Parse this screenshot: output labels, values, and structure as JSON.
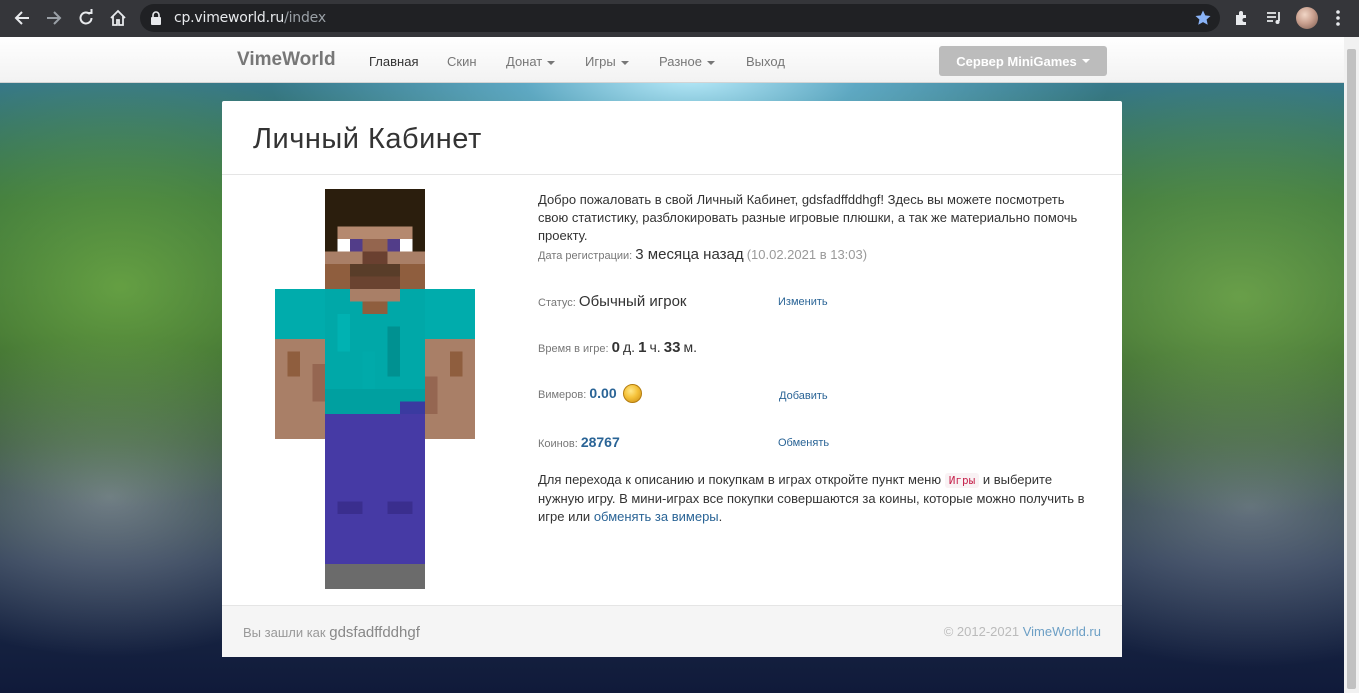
{
  "browser": {
    "url_host": "cp.vimeworld.ru",
    "url_path": "/index",
    "icons": [
      "back-arrow-icon",
      "forward-arrow-icon",
      "reload-icon",
      "home-icon",
      "lock-icon",
      "star-icon",
      "extensions-icon",
      "media-icon",
      "profile-avatar",
      "menu-dots-icon"
    ]
  },
  "navbar": {
    "brand": "VimeWorld",
    "items": [
      {
        "label": "Главная",
        "active": true,
        "dropdown": false
      },
      {
        "label": "Скин",
        "active": false,
        "dropdown": false
      },
      {
        "label": "Донат",
        "active": false,
        "dropdown": true
      },
      {
        "label": "Игры",
        "active": false,
        "dropdown": true
      },
      {
        "label": "Разное",
        "active": false,
        "dropdown": true
      },
      {
        "label": "Выход",
        "active": false,
        "dropdown": false
      }
    ],
    "server_button": "Сервер MiniGames"
  },
  "panel": {
    "title": "Личный Кабинет",
    "welcome": "Добро пожаловать в свой Личный Кабинет, gdsfadffddhgf! Здесь вы можете посмотреть свою статистику, разблокировать разные игровые плюшки, а так же материально помочь проекту.",
    "registration": {
      "label": "Дата регистрации:",
      "value": "3 месяца назад",
      "exact": "(10.02.2021 в 13:03)"
    },
    "status": {
      "label": "Статус:",
      "value": "Обычный игрок",
      "action": "Изменить"
    },
    "playtime": {
      "label": "Время в игре:",
      "days": "0",
      "days_unit": "д.",
      "hours": "1",
      "hours_unit": "ч.",
      "minutes": "33",
      "minutes_unit": "м."
    },
    "vimers": {
      "label": "Вимеров:",
      "value": "0.00",
      "action": "Добавить"
    },
    "coins": {
      "label": "Коинов:",
      "value": "28767",
      "action": "Обменять"
    },
    "info": {
      "part1": "Для перехода к описанию и покупкам в играх откройте пункт меню",
      "code": "Игры",
      "part2": "и выберите нужную игру. В мини-играх все покупки совершаются за коины, которые можно получить в игре или",
      "link": "обменять за вимеры",
      "end": "."
    }
  },
  "footer": {
    "logged_in_prefix": "Вы зашли как",
    "username": "gdsfadffddhgf",
    "copyright": "© 2012-2021",
    "site": "VimeWorld.ru"
  },
  "colors": {
    "accent_link": "#2a6496",
    "server_button": "#bcbcbc",
    "chrome_bar": "#35363a",
    "star": "#8ab4f8"
  }
}
